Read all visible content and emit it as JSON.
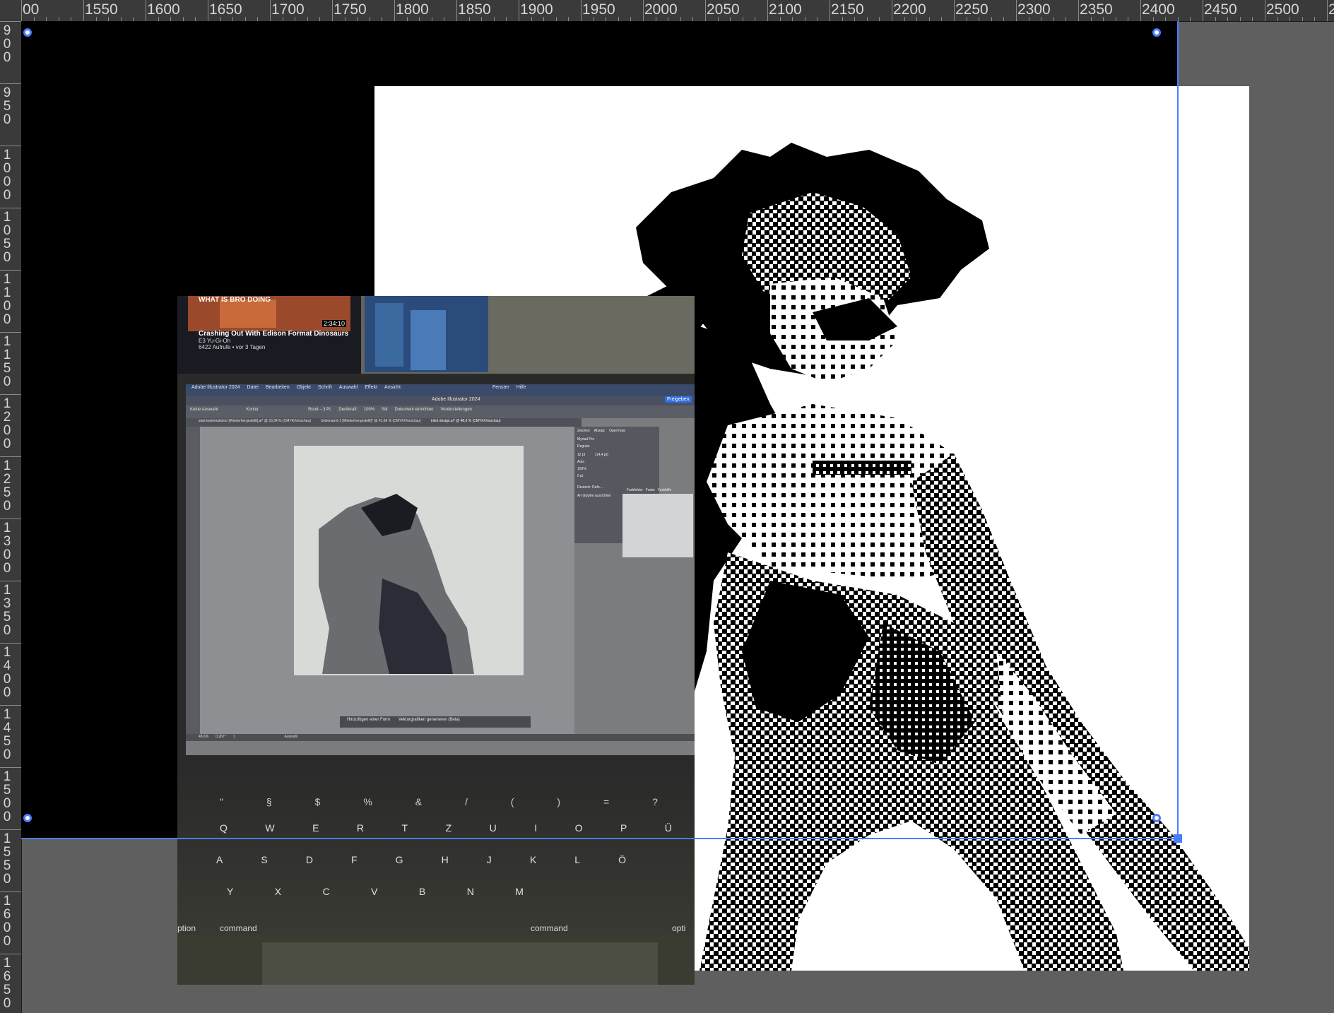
{
  "app": {
    "name": "Adobe Illustrator 2024",
    "document_tabs": [
      "stammarkeraticker [Wiederhergestellt].ai* @ 23,34 % (CMYK/Vorschau)",
      "Unbenannt-1 [Wiederhergestellt]* @ 41,66 % (CMYK/Vorschau)",
      "trikot design.ai* @ 48,6 % (CMYK/Vorschau)"
    ]
  },
  "rulers": {
    "top_labels": [
      "00",
      "1550",
      "1600",
      "1650",
      "1700",
      "1750",
      "1800",
      "1850",
      "1900",
      "1950",
      "2000",
      "2050",
      "2100",
      "2150",
      "2200",
      "2250",
      "2300",
      "2350",
      "2400",
      "2450",
      "2500",
      "25"
    ],
    "left_labels": [
      "900",
      "950",
      "1000",
      "1050",
      "1100",
      "1150",
      "1200",
      "1250",
      "1300",
      "1350",
      "1400",
      "1450",
      "1500",
      "1550",
      "1600",
      "1650",
      "1"
    ]
  },
  "embedded_photo": {
    "youtube_card": {
      "title": "Crashing Out With Edison Format Dinosaurs",
      "channel": "E3 Yu-Gi-Oh",
      "meta": "6422 Aufrufe • vor 3 Tagen",
      "duration": "2:34:10",
      "thumb_text": "WHAT IS BRO DOING"
    },
    "menubar": [
      "Adobe Illustrator 2024",
      "Datei",
      "Bearbeiten",
      "Objekt",
      "Schrift",
      "Auswahl",
      "Effekt",
      "Ansicht",
      "Fenster",
      "Hilfe"
    ],
    "window_title": "Adobe Illustrator 2024",
    "share_button": "Freigeben",
    "control_bar": {
      "selection": "Keine Auswahl",
      "stroke": "Kontur",
      "brush": "Rund – 3 Pt.",
      "opacity_label": "Deckkraft",
      "opacity": "100%",
      "style": "Stil",
      "setup": "Dokument einrichten",
      "prefs": "Voreinstellungen"
    },
    "char_panel": {
      "tabs": [
        "Zeichen",
        "Absatz",
        "OpenType"
      ],
      "font": "Myriad Pro",
      "style": "Regular",
      "size": "12 pt",
      "leading": "(14,4 pt)",
      "kerning": "Auto",
      "scale": "100%",
      "baseline": "0 pt",
      "language": "Deutsch: Refo…",
      "align_glyph": "An Glyphe ausrichten"
    },
    "swatch_tabs": [
      "Farbfelder",
      "Farbe",
      "Farbhilfe"
    ],
    "contextual_bar": [
      "Hinzufügen einer Form",
      "Vektorgrafiken generieren (Beta)"
    ],
    "status_bar": {
      "zoom": "48,6%",
      "angle": "0,267°",
      "page": "1",
      "tool": "Auswahl"
    },
    "keyboard": {
      "row1": [
        "Q",
        "W",
        "E",
        "R",
        "T",
        "Z",
        "U",
        "I",
        "O",
        "P",
        "Ü"
      ],
      "row2": [
        "A",
        "S",
        "D",
        "F",
        "G",
        "H",
        "J",
        "K",
        "L",
        "Ö"
      ],
      "row3": [
        "Y",
        "X",
        "C",
        "V",
        "B",
        "N",
        "M"
      ],
      "modifiers": [
        "ption",
        "command",
        "command",
        "opti"
      ],
      "numbers": [
        "\"",
        "§",
        "$",
        "%",
        "&",
        "/",
        "(",
        ")",
        "=",
        "?"
      ]
    }
  },
  "colors": {
    "pasteboard": "#5f5f5f",
    "ruler_bg": "#3a3a3a",
    "guide": "#4a7cff",
    "black_area": "#000000",
    "artboard": "#ffffff"
  }
}
